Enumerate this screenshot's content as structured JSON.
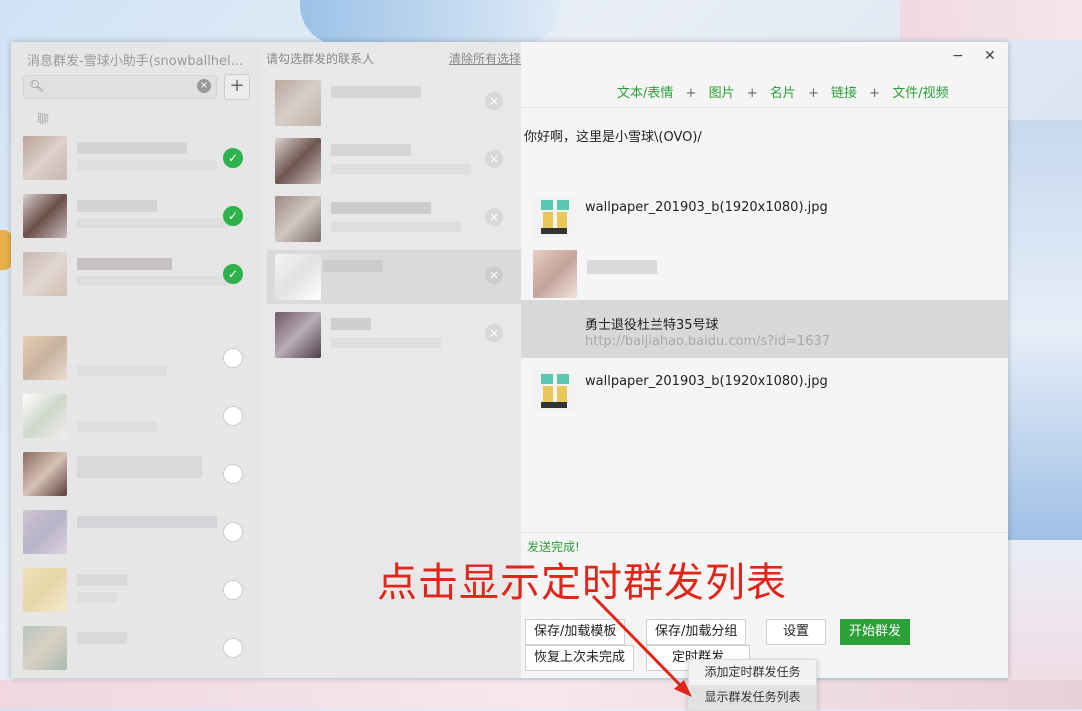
{
  "app": {
    "title": "消息群发-雪球小助手(snowballhel..."
  },
  "left_panel": {
    "search_placeholder": "",
    "section_label": "聊",
    "contacts": [
      {
        "checked": true
      },
      {
        "checked": true
      },
      {
        "checked": true
      },
      {
        "checked": false
      },
      {
        "checked": false
      },
      {
        "checked": false
      },
      {
        "checked": false
      },
      {
        "checked": false
      },
      {
        "checked": false
      }
    ]
  },
  "middle_panel": {
    "title": "请勾选群发的联系人",
    "clear_all": "清除所有选择"
  },
  "composer": {
    "toolbar": {
      "text_emoji": "文本/表情",
      "image": "图片",
      "card": "名片",
      "link": "链接",
      "file_video": "文件/视频",
      "plus": "+"
    },
    "message_text": "你好啊，这里是小雪球\\(OVO)/",
    "attachments": [
      {
        "name": "wallpaper_201903_b(1920x1080).jpg"
      },
      {
        "name": ""
      },
      {
        "name": "勇士退役杜兰特35号球",
        "url": "http://baijiahao.baidu.com/s?id=1637"
      },
      {
        "name": "wallpaper_201903_b(1920x1080).jpg"
      }
    ],
    "status": "发送完成!",
    "buttons": {
      "save_template": "保存/加载模板",
      "save_group": "保存/加载分组",
      "settings": "设置",
      "start": "开始群发",
      "restore": "恢复上次未完成",
      "scheduled": "定时群发"
    }
  },
  "dropdown": {
    "add_task": "添加定时群发任务",
    "show_list": "显示群发任务列表"
  },
  "annotation": "点击显示定时群发列表",
  "window_controls": {
    "minimize": "−",
    "close": "✕"
  },
  "colors": {
    "accent_green": "#2aa036",
    "annotation_red": "#e0261a",
    "check_green": "#2fb24c"
  }
}
